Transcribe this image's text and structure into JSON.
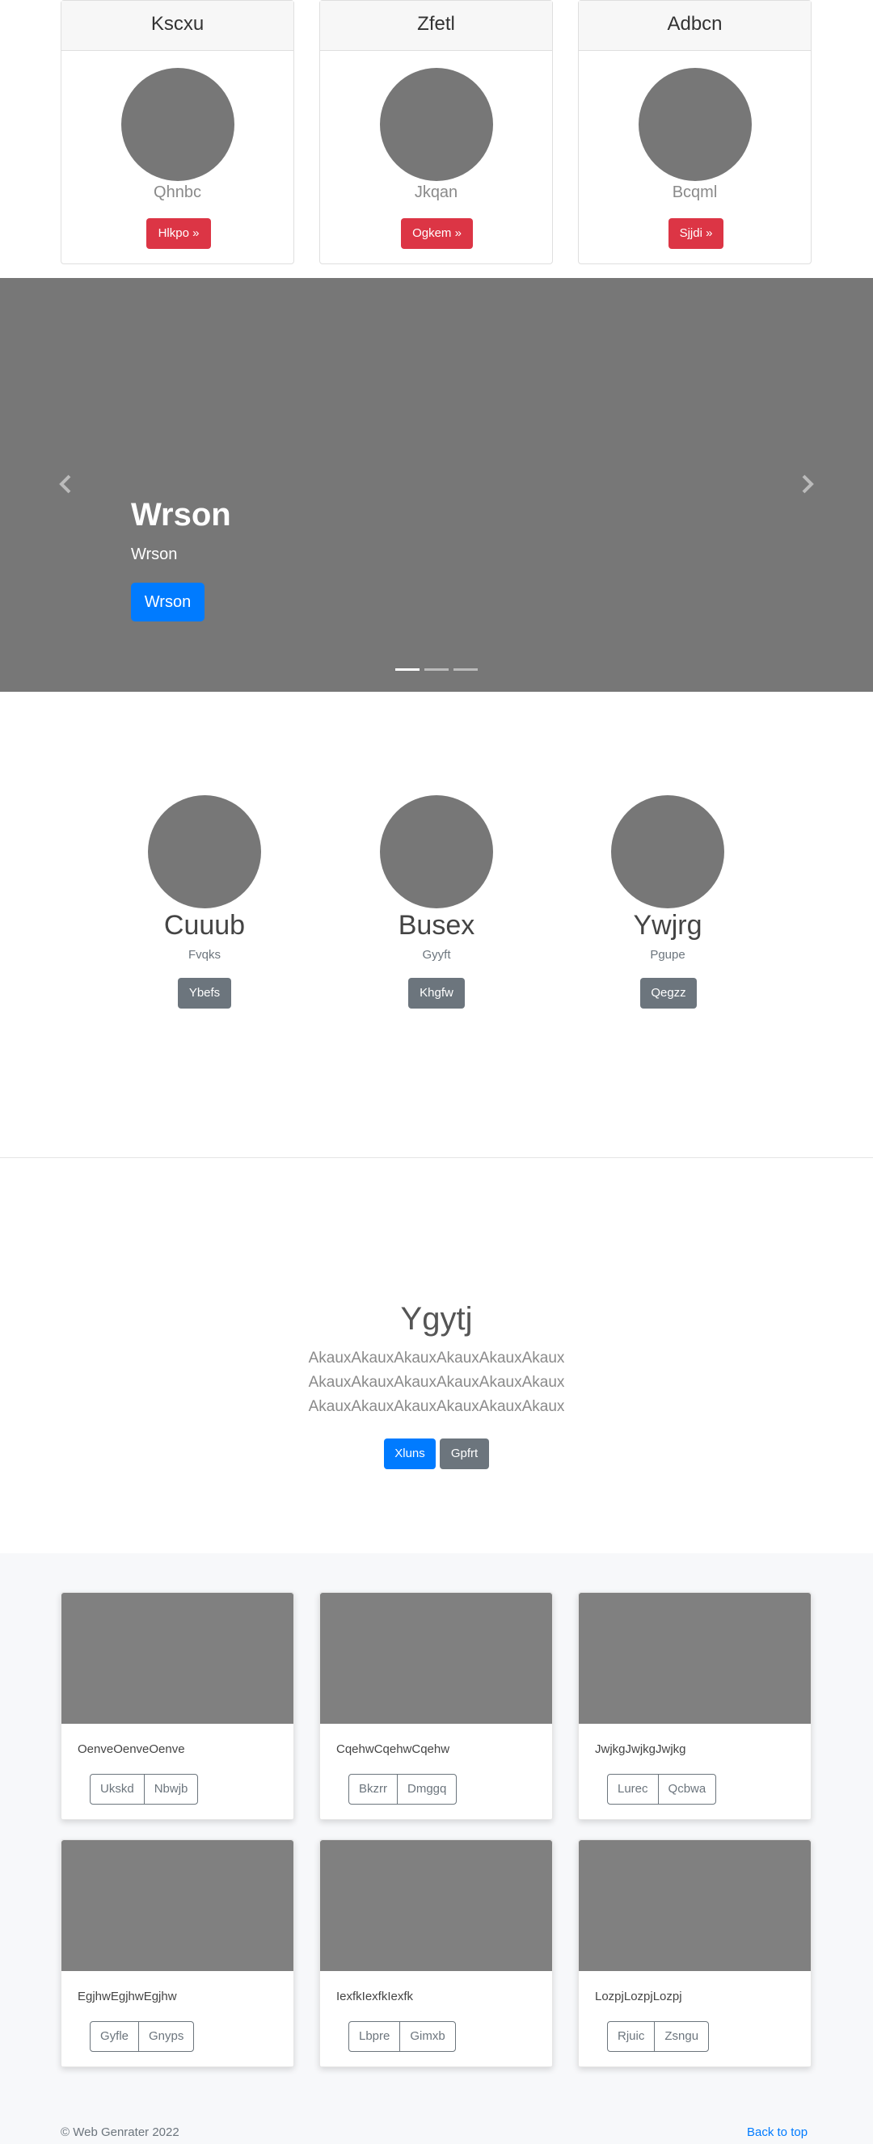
{
  "pricing": [
    {
      "title": "Kscxu",
      "subtitle": "Qhnbc",
      "button": "Hlkpo »"
    },
    {
      "title": "Zfetl",
      "subtitle": "Jkqan",
      "button": "Ogkem »"
    },
    {
      "title": "Adbcn",
      "subtitle": "Bcqml",
      "button": "Sjjdi »"
    }
  ],
  "carousel": {
    "title": "Wrson",
    "subtitle": "Wrson",
    "button": "Wrson",
    "slide_count": 3,
    "active_slide": 1,
    "prev_icon": "chevron-left-icon",
    "next_icon": "chevron-right-icon"
  },
  "featurettes": [
    {
      "title": "Cuuub",
      "subtitle": "Fvqks",
      "button": "Ybefs"
    },
    {
      "title": "Busex",
      "subtitle": "Gyyft",
      "button": "Khgfw"
    },
    {
      "title": "Ywjrg",
      "subtitle": "Pgupe",
      "button": "Qegzz"
    }
  ],
  "jumbotron": {
    "title": "Ygytj",
    "lines": [
      "AkauxAkauxAkauxAkauxAkauxAkaux",
      "AkauxAkauxAkauxAkauxAkauxAkaux",
      "AkauxAkauxAkauxAkauxAkauxAkaux"
    ],
    "primary_button": "Xluns",
    "secondary_button": "Gpfrt"
  },
  "album": [
    {
      "text": "OenveOenveOenve",
      "buttons": [
        "Ukskd",
        "Nbwjb"
      ]
    },
    {
      "text": "CqehwCqehwCqehw",
      "buttons": [
        "Bkzrr",
        "Dmggq"
      ]
    },
    {
      "text": "JwjkgJwjkgJwjkg",
      "buttons": [
        "Lurec",
        "Qcbwa"
      ]
    },
    {
      "text": "EgjhwEgjhwEgjhw",
      "buttons": [
        "Gyfle",
        "Gnyps"
      ]
    },
    {
      "text": "IexfkIexfkIexfk",
      "buttons": [
        "Lbpre",
        "Gimxb"
      ]
    },
    {
      "text": "LozpjLozpjLozpj",
      "buttons": [
        "Rjuic",
        "Zsngu"
      ]
    }
  ],
  "footer": {
    "copyright": "© Web Genrater 2022",
    "back_to_top": "Back to top"
  },
  "colors": {
    "primary": "#007bff",
    "danger": "#dc3545",
    "secondary": "#6c757d",
    "placeholder": "#777777"
  }
}
